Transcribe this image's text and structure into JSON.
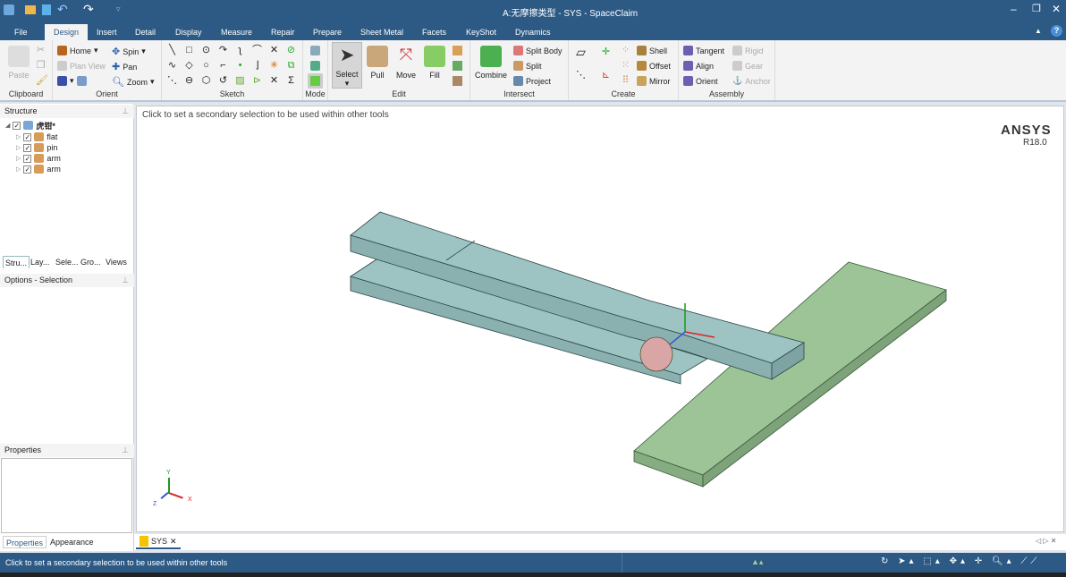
{
  "title": "A:无摩擦类型 - SYS - SpaceClaim",
  "quick_access": [
    "app-icon",
    "open-icon",
    "save-icon",
    "undo-icon",
    "redo-icon",
    "customize-icon"
  ],
  "tabs": [
    "File",
    "Design",
    "Insert",
    "Detail",
    "Display",
    "Measure",
    "Repair",
    "Prepare",
    "Sheet Metal",
    "Facets",
    "KeyShot",
    "Dynamics"
  ],
  "active_tab": "Design",
  "ribbon": {
    "clipboard": {
      "label": "Clipboard",
      "paste": "Paste"
    },
    "orient": {
      "label": "Orient",
      "home": "Home",
      "plan_view": "Plan View",
      "spin": "Spin",
      "pan": "Pan",
      "zoom": "Zoom"
    },
    "sketch": {
      "label": "Sketch"
    },
    "mode": {
      "label": "Mode"
    },
    "edit": {
      "label": "Edit",
      "select": "Select",
      "pull": "Pull",
      "move": "Move",
      "fill": "Fill"
    },
    "intersect": {
      "label": "Intersect",
      "combine": "Combine",
      "split_body": "Split Body",
      "split": "Split",
      "project": "Project"
    },
    "create": {
      "label": "Create",
      "shell": "Shell",
      "offset": "Offset",
      "mirror": "Mirror"
    },
    "assembly": {
      "label": "Assembly",
      "tangent": "Tangent",
      "align": "Align",
      "orient": "Orient",
      "rigid": "Rigid",
      "gear": "Gear",
      "anchor": "Anchor"
    }
  },
  "structure": {
    "title": "Structure",
    "root": "虎钳*",
    "items": [
      "flat",
      "pin",
      "arm",
      "arm"
    ]
  },
  "left_tabs": [
    "Stru...",
    "Lay...",
    "Sele...",
    "Gro...",
    "Views"
  ],
  "options_title": "Options - Selection",
  "properties_title": "Properties",
  "bottom_tabs": [
    "Properties",
    "Appearance"
  ],
  "viewport": {
    "hint": "Click to set a secondary selection to be used within other tools",
    "brand": "ANSYS",
    "version": "R18.0",
    "axes": {
      "x": "X",
      "y": "Y",
      "z": "Z"
    }
  },
  "doc_tab": "SYS",
  "status_text": "Click to set a secondary selection to be used within other tools",
  "colors": {
    "titlebar": "#2c5a85",
    "arm": "#9ec3c3",
    "plate": "#9cc497",
    "pin": "#d9a5a5"
  }
}
